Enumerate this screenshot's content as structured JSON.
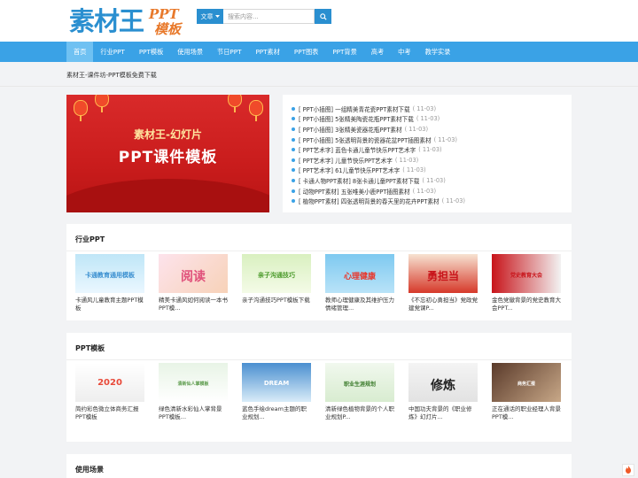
{
  "logo": {
    "main": "素材王",
    "sub1": "PPT",
    "sub2": "模板"
  },
  "search": {
    "select_label": "文章",
    "placeholder": "搜索内容..."
  },
  "nav": {
    "items": [
      "首页",
      "行业PPT",
      "PPT模板",
      "使用场景",
      "节日PPT",
      "PPT素材",
      "PPT图表",
      "PPT背景",
      "高考",
      "中考",
      "教学实录"
    ]
  },
  "breadcrumb": "素材王-课件坊-PPT模板免费下载",
  "banner": {
    "line1": "素材王-幻灯片",
    "line2": "PPT课件模板"
  },
  "news": [
    {
      "title": "[ PPT小插图] 一组精美青花瓷PPT素材下载",
      "date": "( 11-03)"
    },
    {
      "title": "[ PPT小插图] 5张精美陶瓷花瓶PPT素材下载",
      "date": "( 11-03)"
    },
    {
      "title": "[ PPT小插图] 3张精美瓷器花瓶PPT素材",
      "date": "( 11-03)"
    },
    {
      "title": "[ PPT小插图] 5张透明背景的瓷器花盆PPT插图素材",
      "date": "( 11-03)"
    },
    {
      "title": "[ PPT艺术字] 蓝色卡通儿童节快乐PPT艺术字",
      "date": "( 11-03)"
    },
    {
      "title": "[ PPT艺术字] 儿童节快乐PPT艺术字",
      "date": "( 11-03)"
    },
    {
      "title": "[ PPT艺术字] 61儿童节快乐PPT艺术字",
      "date": "( 11-03)"
    },
    {
      "title": "[ 卡通人物PPT素材] 8张卡通儿童PPT素材下载",
      "date": "( 11-03)"
    },
    {
      "title": "[ 动物PPT素材] 五张唯美小鹿PPT插图素材",
      "date": "( 11-03)"
    },
    {
      "title": "[ 植物PPT素材] 四张透明背景的春天里的花卉PPT素材",
      "date": "( 11-03)"
    }
  ],
  "panels": [
    {
      "title": "行业PPT",
      "cards": [
        {
          "title": "卡通风儿童教育主题PPT模板",
          "thumb_text": "卡通教育通用模板"
        },
        {
          "title": "精美卡通风如何阅读一本书PPT模...",
          "thumb_text": "阅读"
        },
        {
          "title": "亲子沟通技巧PPT模板下载",
          "thumb_text": "亲子沟通技巧"
        },
        {
          "title": "教师心理健康及其维护压力情绪管理...",
          "thumb_text": "心理健康"
        },
        {
          "title": "《不忘初心勇担当》党政党建党课P...",
          "thumb_text": "勇担当"
        },
        {
          "title": "金色党徽背景的党史教育大会PPT...",
          "thumb_text": "党史教育大会"
        }
      ]
    },
    {
      "title": "PPT模板",
      "cards": [
        {
          "title": "简约彩色微立体商务汇报PPT模板",
          "thumb_text": "2020"
        },
        {
          "title": "绿色清新水彩仙人掌背景PPT模板...",
          "thumb_text": "清新仙人掌模板"
        },
        {
          "title": "蓝色手绘dream主题的职业规划...",
          "thumb_text": "DREAM"
        },
        {
          "title": "清新绿色植物背景的个人职业规划P...",
          "thumb_text": "职业生涯规划"
        },
        {
          "title": "中国功夫背景的《职业修炼》幻灯片...",
          "thumb_text": "修炼"
        },
        {
          "title": "正在通话的职业经理人背景PPT模...",
          "thumb_text": "商务汇报"
        }
      ]
    },
    {
      "title": "使用场景",
      "cards": []
    }
  ],
  "colors": {
    "brand": "#2a8fd0",
    "nav": "#3aa2e6",
    "nav_active": "#6fc1f2",
    "accent": "#e8792b"
  }
}
